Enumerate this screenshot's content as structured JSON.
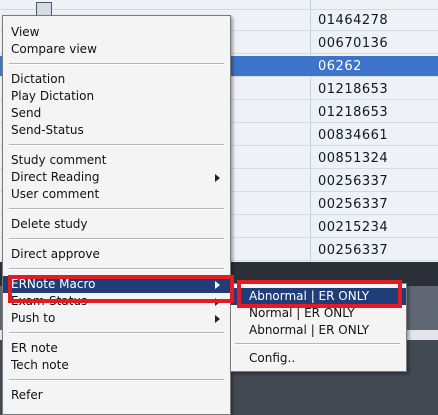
{
  "grid": {
    "rows": [
      {
        "id": "01464278",
        "selected": false
      },
      {
        "id": "00670136",
        "selected": false
      },
      {
        "id": "06262",
        "selected": true
      },
      {
        "id": "01218653",
        "selected": false
      },
      {
        "id": "01218653",
        "selected": false
      },
      {
        "id": "00834661",
        "selected": false
      },
      {
        "id": "00851324",
        "selected": false
      },
      {
        "id": "00256337",
        "selected": false
      },
      {
        "id": "00256337",
        "selected": false
      },
      {
        "id": "00215234",
        "selected": false
      },
      {
        "id": "00256337",
        "selected": false
      }
    ]
  },
  "context_menu": {
    "items": [
      {
        "label": "View",
        "submenu": false
      },
      {
        "label": "Compare view",
        "submenu": false
      },
      {
        "label": "Dictation",
        "submenu": false
      },
      {
        "label": "Play Dictation",
        "submenu": false
      },
      {
        "label": "Send",
        "submenu": false
      },
      {
        "label": "Send-Status",
        "submenu": false
      },
      {
        "label": "Study comment",
        "submenu": false
      },
      {
        "label": "Direct Reading",
        "submenu": true
      },
      {
        "label": "User comment",
        "submenu": false
      },
      {
        "label": "Delete study",
        "submenu": false
      },
      {
        "label": "Direct approve",
        "submenu": false
      },
      {
        "label": "ERNote Macro",
        "submenu": true,
        "highlighted": true
      },
      {
        "label": "Exam-Status",
        "submenu": true
      },
      {
        "label": "Push to",
        "submenu": true
      },
      {
        "label": "ER note",
        "submenu": false
      },
      {
        "label": "Tech note",
        "submenu": false
      },
      {
        "label": "Refer",
        "submenu": false
      }
    ]
  },
  "submenu": {
    "items": [
      {
        "label": "Abnormal | ER ONLY",
        "highlighted": true
      },
      {
        "label": "Normal | ER ONLY",
        "highlighted": false
      },
      {
        "label": "Abnormal | ER ONLY",
        "highlighted": false
      },
      {
        "label": "Config..",
        "highlighted": false
      }
    ]
  },
  "colors": {
    "highlight": "#1f3d78",
    "selected_row": "#3d74c9",
    "callout": "#e41b23"
  }
}
